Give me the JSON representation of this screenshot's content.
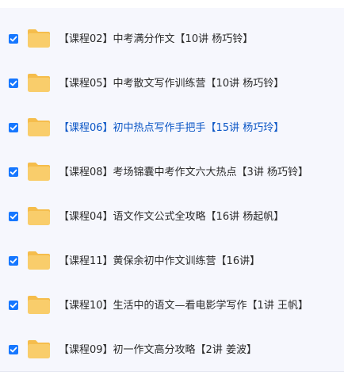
{
  "file_list": {
    "items": [
      {
        "label": "【课程02】中考满分作文【10讲 杨巧铃】",
        "checked": true,
        "active": false
      },
      {
        "label": "【课程05】中考散文写作训练营【10讲 杨巧铃】",
        "checked": true,
        "active": false
      },
      {
        "label": "【课程06】初中热点写作手把手【15讲 杨巧玲】",
        "checked": true,
        "active": true
      },
      {
        "label": "【课程08】考场锦囊中考作文六大热点【3讲 杨巧铃】",
        "checked": true,
        "active": false
      },
      {
        "label": "【课程04】语文作文公式全攻略【16讲 杨起帆】",
        "checked": true,
        "active": false
      },
      {
        "label": "【课程11】黄保余初中作文训练营【16讲】",
        "checked": true,
        "active": false
      },
      {
        "label": "【课程10】生活中的语文—看电影学写作【1讲 王帆】",
        "checked": true,
        "active": false
      },
      {
        "label": "【课程09】初一作文高分攻略【2讲 姜波】",
        "checked": true,
        "active": false
      }
    ]
  },
  "icons": {
    "checkbox": "checkbox-checked-icon",
    "item": "folder-icon"
  },
  "colors": {
    "checkbox": "#1677ff",
    "folder": "#f9cd6b",
    "folder_back": "#f5bd4c",
    "active_text": "#0b56c6",
    "text": "#2b2b2b",
    "panel_background": "#f6f7fd"
  }
}
